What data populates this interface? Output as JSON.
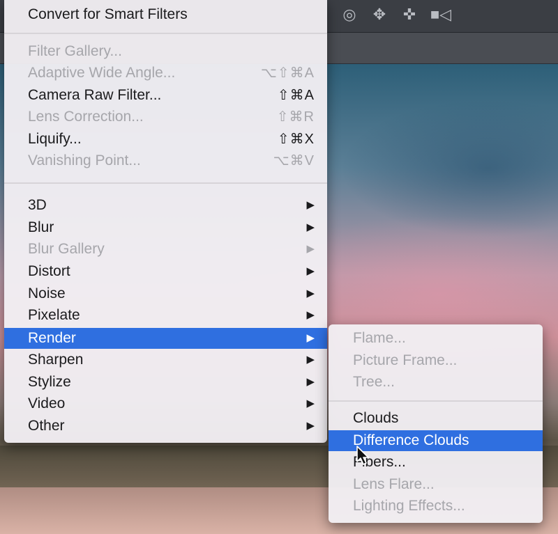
{
  "toolbar": {
    "icons": [
      "rotate-3d-icon",
      "pan-3d-icon",
      "slide-3d-icon",
      "video-camera-icon"
    ]
  },
  "filter_menu": {
    "items_top": [
      {
        "label": "Convert for Smart Filters",
        "shortcut": "",
        "enabled": true
      }
    ],
    "items_filters": [
      {
        "label": "Filter Gallery...",
        "shortcut": "",
        "enabled": false
      },
      {
        "label": "Adaptive Wide Angle...",
        "shortcut": "⌥⇧⌘A",
        "enabled": false
      },
      {
        "label": "Camera Raw Filter...",
        "shortcut": "⇧⌘A",
        "enabled": true
      },
      {
        "label": "Lens Correction...",
        "shortcut": "⇧⌘R",
        "enabled": false
      },
      {
        "label": "Liquify...",
        "shortcut": "⇧⌘X",
        "enabled": true
      },
      {
        "label": "Vanishing Point...",
        "shortcut": "⌥⌘V",
        "enabled": false
      }
    ],
    "items_categories": [
      {
        "label": "3D",
        "enabled": true
      },
      {
        "label": "Blur",
        "enabled": true
      },
      {
        "label": "Blur Gallery",
        "enabled": false
      },
      {
        "label": "Distort",
        "enabled": true
      },
      {
        "label": "Noise",
        "enabled": true
      },
      {
        "label": "Pixelate",
        "enabled": true
      },
      {
        "label": "Render",
        "enabled": true,
        "highlighted": true
      },
      {
        "label": "Sharpen",
        "enabled": true
      },
      {
        "label": "Stylize",
        "enabled": true
      },
      {
        "label": "Video",
        "enabled": true
      },
      {
        "label": "Other",
        "enabled": true
      }
    ],
    "submenu_arrow": "▶"
  },
  "render_submenu": {
    "group1": [
      {
        "label": "Flame...",
        "enabled": false
      },
      {
        "label": "Picture Frame...",
        "enabled": false
      },
      {
        "label": "Tree...",
        "enabled": false
      }
    ],
    "group2": [
      {
        "label": "Clouds",
        "enabled": true
      },
      {
        "label": "Difference Clouds",
        "enabled": true,
        "highlighted": true
      },
      {
        "label": "Fibers...",
        "enabled": true
      },
      {
        "label": "Lens Flare...",
        "enabled": false
      },
      {
        "label": "Lighting Effects...",
        "enabled": false
      }
    ]
  },
  "colors": {
    "highlight": "#2f6fe0",
    "menu_bg": "#f1eef2",
    "disabled_text": "#a6a6ab"
  }
}
